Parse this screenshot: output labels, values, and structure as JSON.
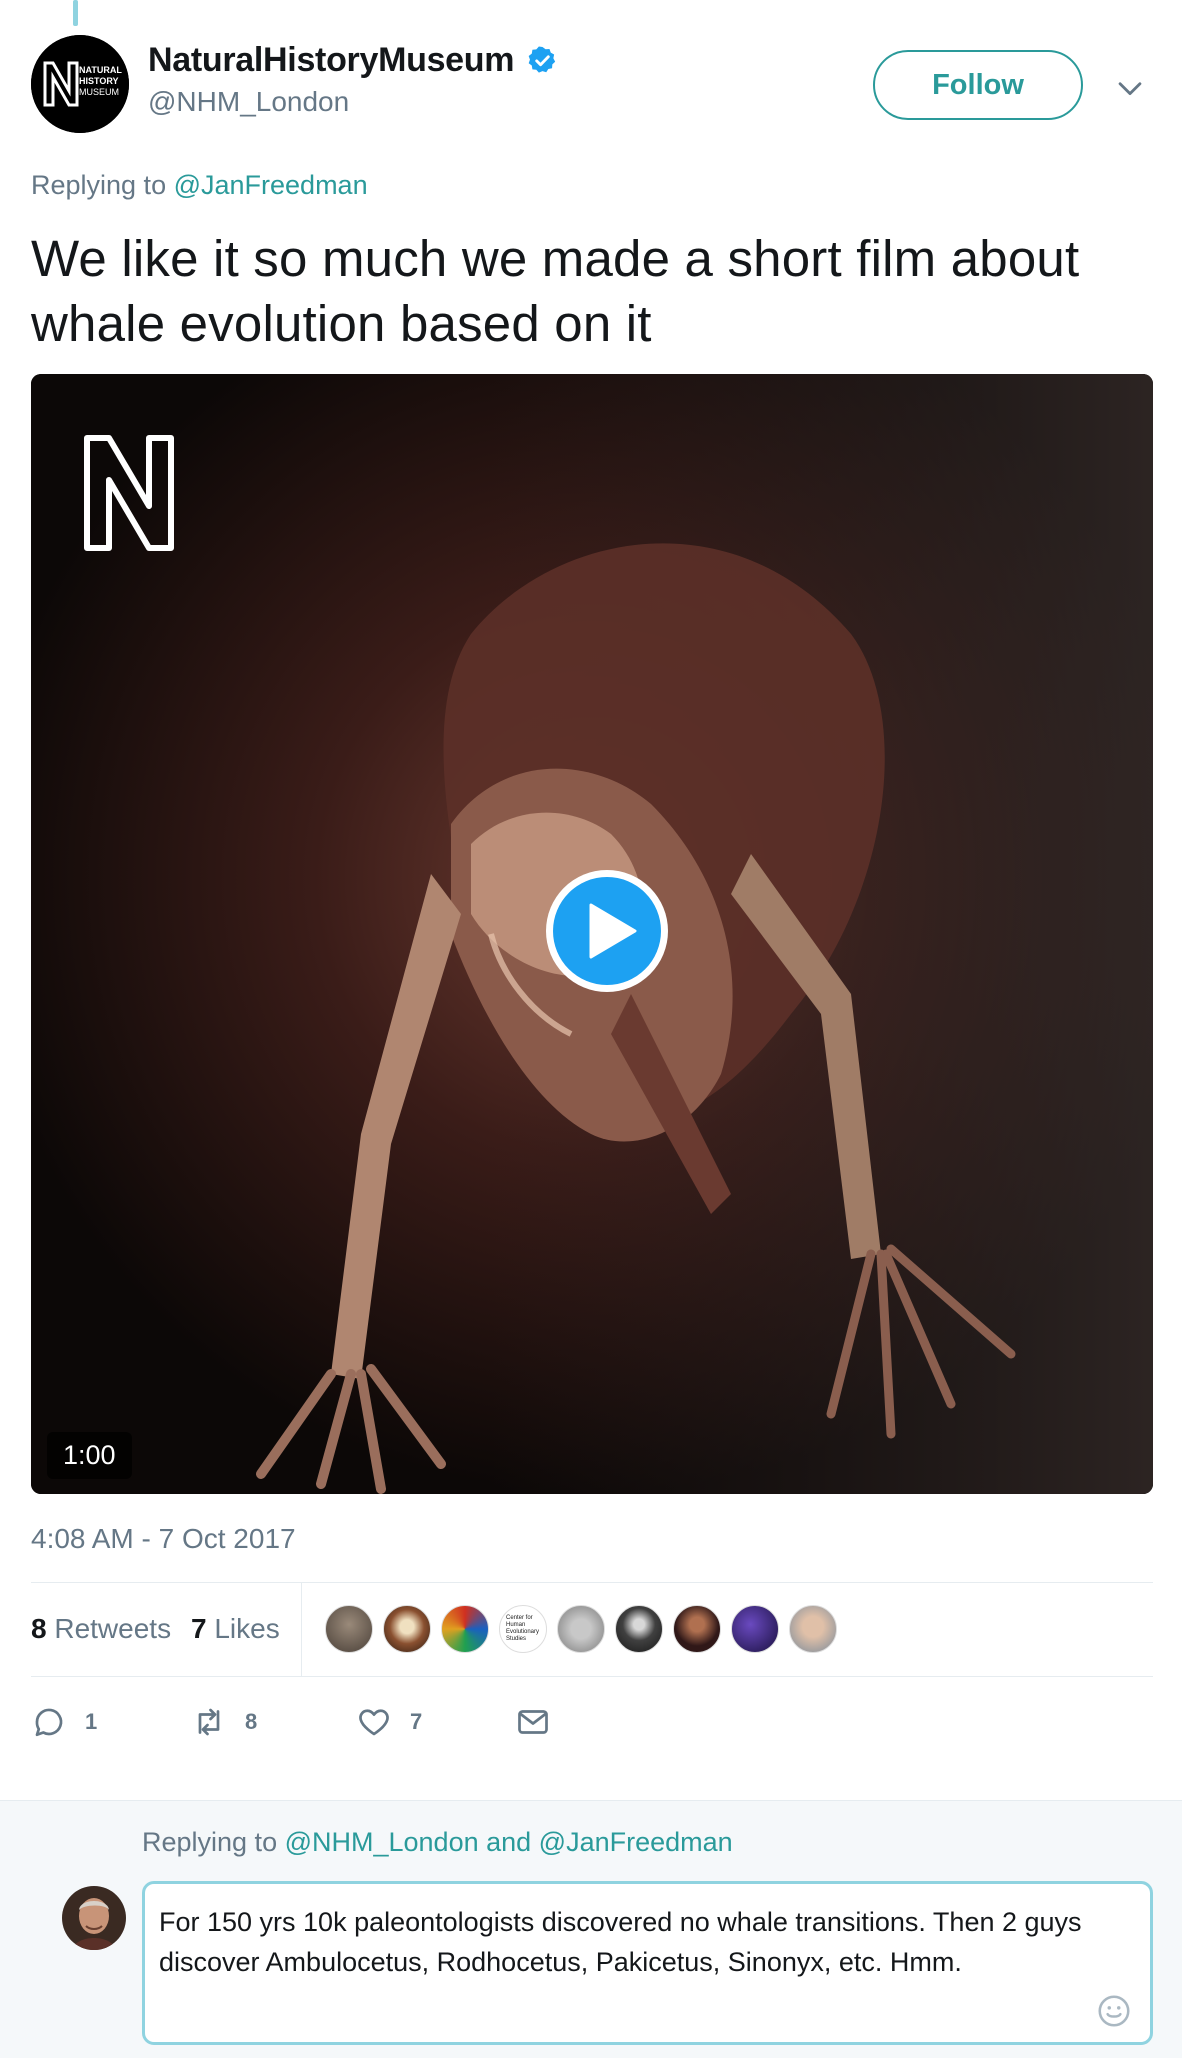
{
  "tweet": {
    "author": {
      "display_name": "NaturalHistoryMuseum",
      "handle": "@NHM_London",
      "avatar_logo_text": [
        "NATURAL",
        "HISTORY",
        "MUSEUM"
      ]
    },
    "follow_label": "Follow",
    "replying_prefix": "Replying to ",
    "replying_to": "@JanFreedman",
    "text": "We like it so much we made a short film about whale evolution based on it",
    "video": {
      "duration": "1:00",
      "logo_letter": "N"
    },
    "timestamp": "4:08 AM - 7 Oct 2017",
    "stats": {
      "retweets_count": "8",
      "retweets_label": " Retweets",
      "likes_count": "7",
      "likes_label": " Likes"
    },
    "liker_avatars": [
      "user-avatar-1",
      "user-avatar-2",
      "user-avatar-3",
      "cfhes-logo-avatar",
      "user-avatar-5",
      "dog-avatar",
      "user-avatar-7",
      "user-avatar-8",
      "user-avatar-9"
    ],
    "liker_logo_text": "Center for Human Evolutionary Studies",
    "actions": {
      "reply_count": "1",
      "retweet_count": "8",
      "like_count": "7"
    }
  },
  "reply": {
    "replying_prefix": "Replying to ",
    "replying_to_1": "@NHM_London",
    "replying_and": " and ",
    "replying_to_2": "@JanFreedman",
    "draft_text": "For 150 yrs 10k paleontologists discovered no whale transitions. Then 2 guys discover Ambulocetus, Rodhocetus, Pakicetus, Sinonyx, etc. Hmm."
  },
  "colors": {
    "accent": "#2a9a9a",
    "play": "#1da1f2",
    "muted": "#657786"
  }
}
